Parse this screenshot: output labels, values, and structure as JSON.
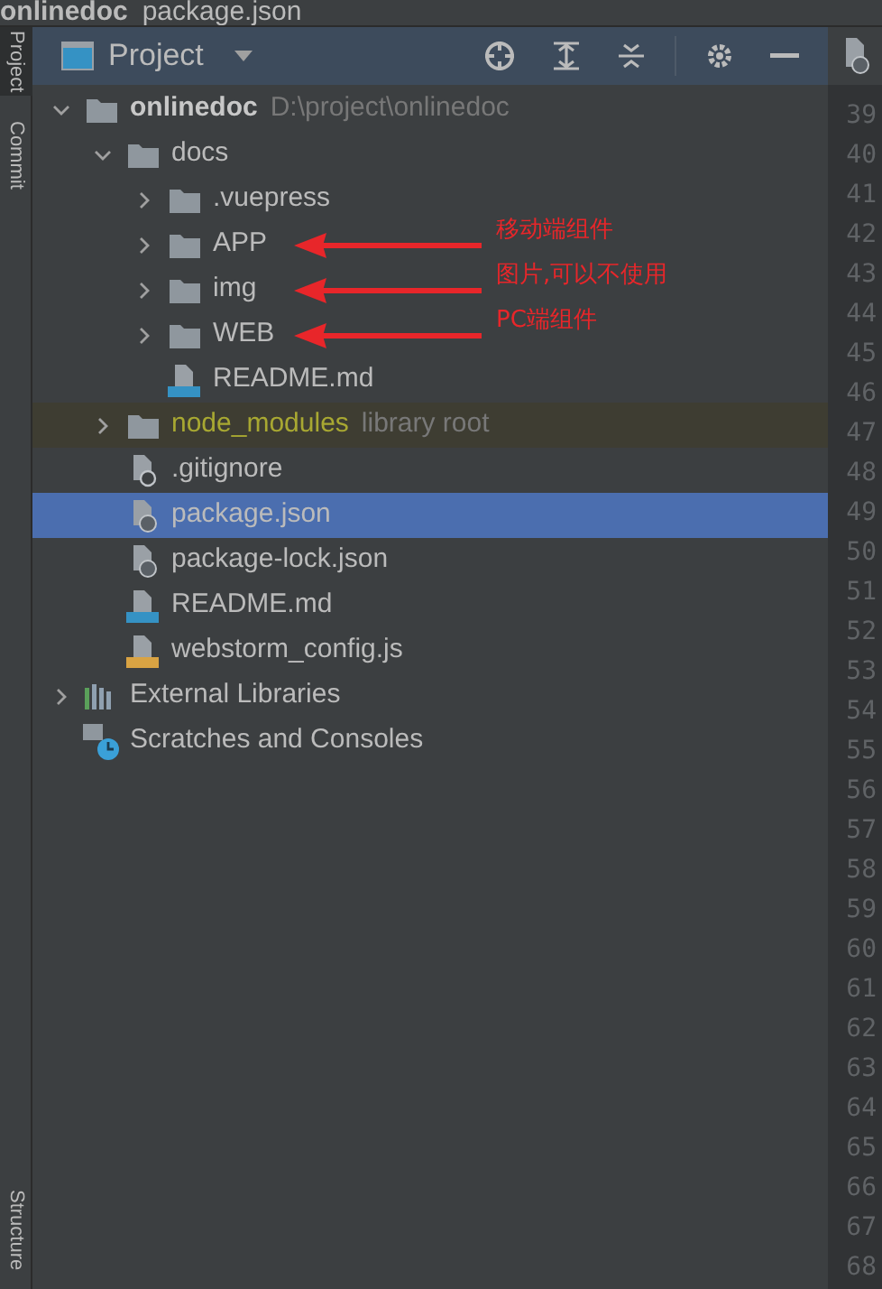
{
  "breadcrumb": [
    "onlinedoc",
    "package.json"
  ],
  "side_tabs": [
    {
      "label": "Project",
      "selected": true
    },
    {
      "label": "Commit",
      "selected": false
    }
  ],
  "side_tabs_bottom": [
    "Structure"
  ],
  "panel": {
    "title": "Project"
  },
  "tree": [
    {
      "name": "onlinedoc",
      "hint": "D:\\project\\onlinedoc",
      "kind": "root",
      "expanded": true,
      "selected": false,
      "children": [
        {
          "name": "docs",
          "kind": "folder",
          "expanded": true,
          "selected": false,
          "children": [
            {
              "name": ".vuepress",
              "kind": "folder",
              "expanded": false,
              "selected": false
            },
            {
              "name": "APP",
              "kind": "folder",
              "expanded": false,
              "selected": false,
              "annotation": "移动端组件"
            },
            {
              "name": "img",
              "kind": "folder",
              "expanded": false,
              "selected": false,
              "annotation": "图片,可以不使用"
            },
            {
              "name": "WEB",
              "kind": "folder",
              "expanded": false,
              "selected": false,
              "annotation": "PC端组件"
            },
            {
              "name": "README.md",
              "kind": "md",
              "selected": false
            }
          ]
        },
        {
          "name": "node_modules",
          "hint": "library root",
          "kind": "library",
          "expanded": false,
          "selected": false
        },
        {
          "name": ".gitignore",
          "kind": "ignore",
          "selected": false
        },
        {
          "name": "package.json",
          "kind": "json",
          "selected": true
        },
        {
          "name": "package-lock.json",
          "kind": "json",
          "selected": false
        },
        {
          "name": "README.md",
          "kind": "md",
          "selected": false
        },
        {
          "name": "webstorm_config.js",
          "kind": "js",
          "selected": false
        }
      ]
    },
    {
      "name": "External Libraries",
      "kind": "libraries",
      "expanded": false,
      "selected": false
    },
    {
      "name": "Scratches and Consoles",
      "kind": "scratches",
      "selected": false
    }
  ],
  "line_numbers": [
    "39",
    "40",
    "41",
    "42",
    "43",
    "44",
    "45",
    "46",
    "47",
    "48",
    "49",
    "50",
    "51",
    "52",
    "53",
    "54",
    "55",
    "56",
    "57",
    "58",
    "59",
    "60",
    "61",
    "62",
    "63",
    "64",
    "65",
    "66",
    "67",
    "68"
  ]
}
